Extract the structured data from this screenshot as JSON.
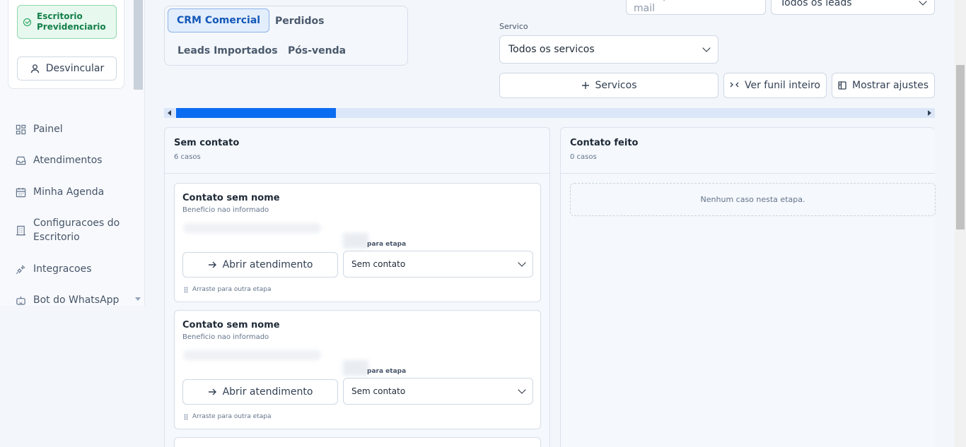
{
  "sidebar": {
    "office_badge": "Escritorio Previdenciario",
    "unlink_label": "Desvincular",
    "items": [
      {
        "label": "Painel",
        "icon": "dashboard-grid-icon"
      },
      {
        "label": "Atendimentos",
        "icon": "inbox-icon"
      },
      {
        "label": "Minha Agenda",
        "icon": "calendar-icon"
      },
      {
        "label": "Configuracoes do Escritorio",
        "icon": "building-icon"
      },
      {
        "label": "Integracoes",
        "icon": "plug-icon"
      },
      {
        "label": "Bot do WhatsApp",
        "icon": "bot-icon"
      }
    ]
  },
  "tabs": [
    {
      "label": "CRM Comercial",
      "active": true
    },
    {
      "label": "Perdidos"
    },
    {
      "label": "Leads Importados"
    },
    {
      "label": "Pós-venda"
    }
  ],
  "filters": {
    "search_placeholder": "Nome, telefone ou e-mail",
    "leads_value": "Todos os leads",
    "service_label": "Servico",
    "service_value": "Todos os servicos"
  },
  "actions": {
    "services_label": "Servicos",
    "funnel_label": "Ver funil inteiro",
    "settings_label": "Mostrar ajustes"
  },
  "board": {
    "scroll_position": 0.207,
    "columns": [
      {
        "title": "Sem contato",
        "count": "6 casos",
        "cards": [
          {
            "name": "Contato sem nome",
            "benefit": "Beneficio nao informado",
            "move_label": "para etapa",
            "open_label": "Abrir atendimento",
            "stage": "Sem contato",
            "drag_hint": "Arraste para outra etapa"
          },
          {
            "name": "Contato sem nome",
            "benefit": "Beneficio nao informado",
            "move_label": "para etapa",
            "open_label": "Abrir atendimento",
            "stage": "Sem contato",
            "drag_hint": "Arraste para outra etapa"
          }
        ]
      },
      {
        "title": "Contato feito",
        "count": "0 casos",
        "empty_text": "Nenhum caso nesta etapa."
      }
    ]
  },
  "colors": {
    "accent": "#0a6cf0",
    "success": "#14804a",
    "active_tab": "#1458b8"
  }
}
